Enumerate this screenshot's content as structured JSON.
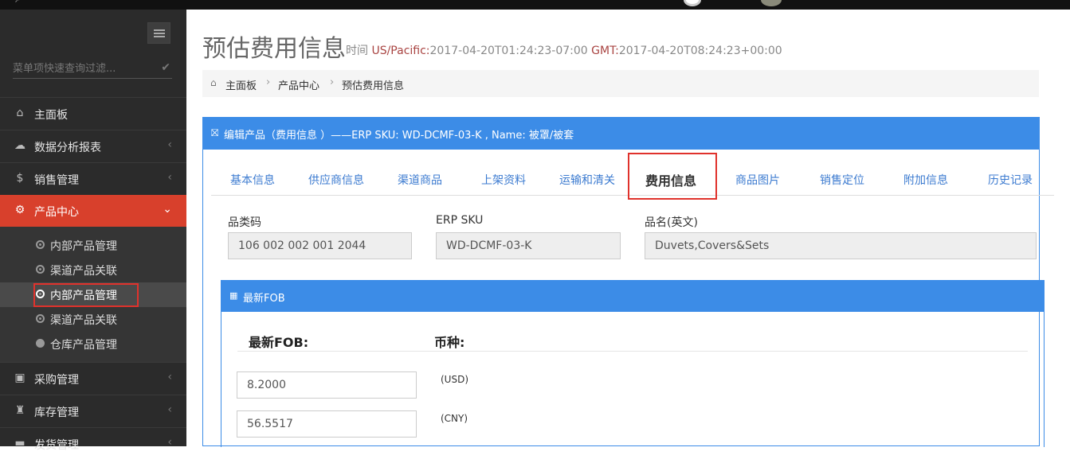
{
  "sidebar": {
    "search_placeholder": "菜单项快速查询过滤...",
    "menu": [
      {
        "label": "主面板",
        "icon": "home-icon"
      },
      {
        "label": "数据分析报表",
        "icon": "cloud-icon"
      },
      {
        "label": "销售管理",
        "icon": "dollar-icon"
      },
      {
        "label": "产品中心",
        "icon": "cogs-icon"
      },
      {
        "label": "采购管理",
        "icon": "cube-icon"
      },
      {
        "label": "库存管理",
        "icon": "android-icon"
      },
      {
        "label": "发货管理",
        "icon": "truck-icon"
      }
    ],
    "submenu": [
      {
        "label": "内部产品管理"
      },
      {
        "label": "渠道产品关联"
      },
      {
        "label": "内部产品管理"
      },
      {
        "label": "渠道产品关联"
      },
      {
        "label": "仓库产品管理"
      }
    ]
  },
  "header": {
    "title": "预估费用信息",
    "time_label": "时间",
    "tz1": "US/Pacific:",
    "time1": "2017-04-20T01:24:23-07:00",
    "tz2": "GMT:",
    "time2": "2017-04-20T08:24:23+00:00"
  },
  "breadcrumb": [
    "主面板",
    "产品中心",
    "预估费用信息"
  ],
  "panel": {
    "title": "编辑产品（费用信息 ）——ERP SKU: WD-DCMF-03-K , Name: 被罩/被套",
    "tabs": [
      "基本信息",
      "供应商信息",
      "渠道商品",
      "上架资料",
      "运输和清关",
      "费用信息",
      "商品图片",
      "销售定位",
      "附加信息",
      "历史记录"
    ],
    "active_tab": "费用信息"
  },
  "fields": {
    "category_label": "品类码",
    "category_value": "106  002  002  001  2044",
    "sku_label": "ERP SKU",
    "sku_value": "WD-DCMF-03-K",
    "name_label": "品名(英文)",
    "name_value": "Duvets,Covers&Sets"
  },
  "fob": {
    "title": "最新FOB",
    "col1": "最新FOB:",
    "col2": "币种:",
    "rows": [
      {
        "value": "8.2000",
        "currency": "(USD)"
      },
      {
        "value": "56.5517",
        "currency": "(CNY)"
      }
    ]
  },
  "colors": {
    "accent": "#3c8ce7",
    "active_menu": "#d8402c",
    "highlight_box": "#e0322c"
  }
}
